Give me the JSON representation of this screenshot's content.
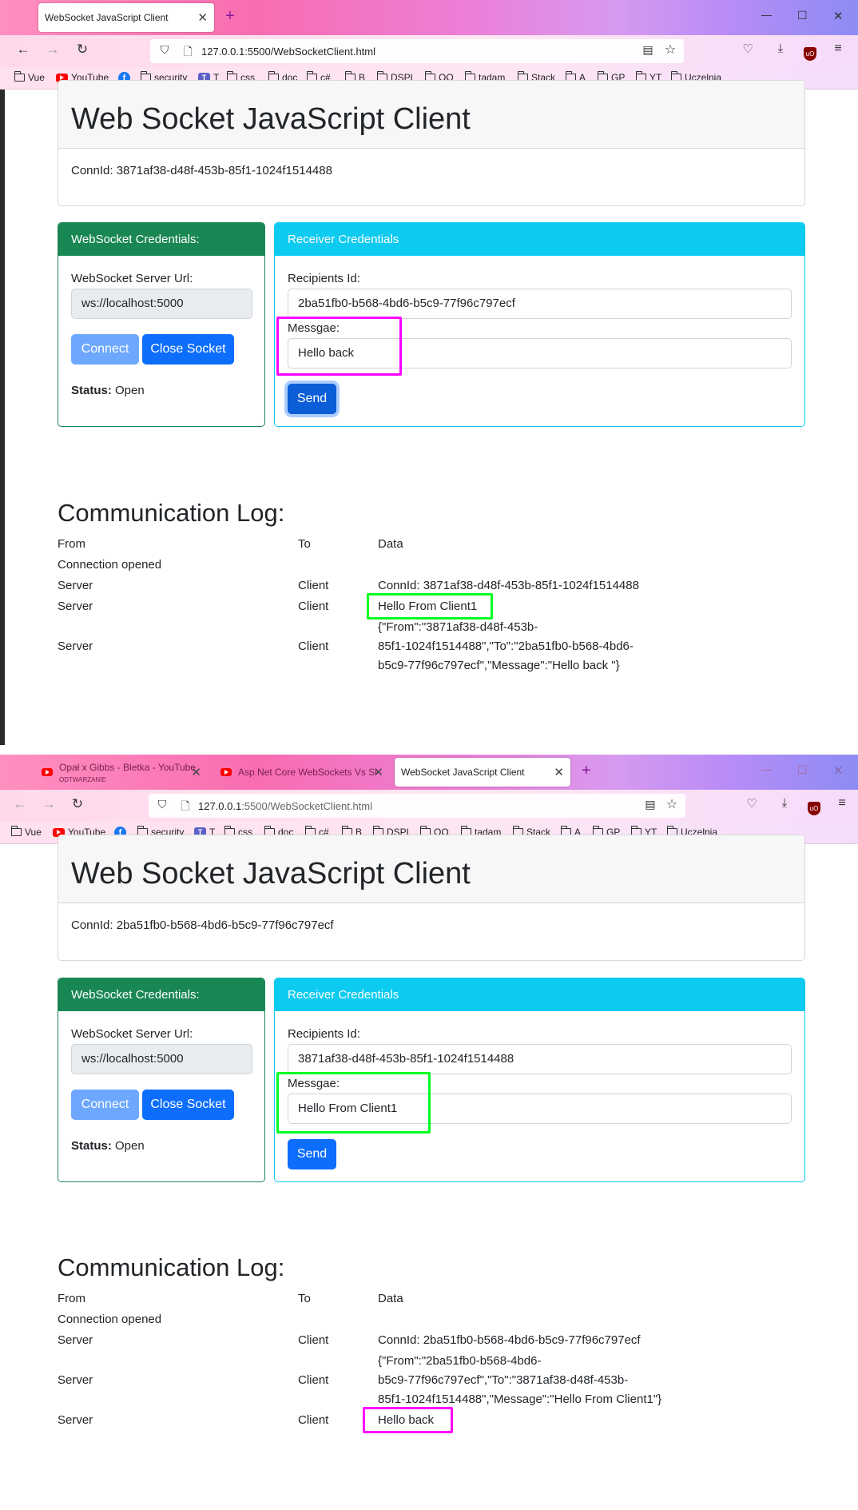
{
  "windows": [
    {
      "tabs": [
        {
          "label": "WebSocket JavaScript Client",
          "active": true
        }
      ],
      "url": {
        "host": "127.0.0.1",
        "rest": ":5500/WebSocketClient.html"
      },
      "page": {
        "title": "Web Socket JavaScript Client",
        "conn_id": "ConnId: 3871af38-d48f-453b-85f1-1024f1514488",
        "ws_panel": {
          "header": "WebSocket Credentials:",
          "url_label": "WebSocket Server Url:",
          "url_value": "ws://localhost:5000",
          "connect_label": "Connect",
          "close_label": "Close Socket",
          "status_label": "Status:",
          "status_value": "Open"
        },
        "receiver_panel": {
          "header": "Receiver Credentials",
          "recipients_label": "Recipients Id:",
          "recipients_value": "2ba51fb0-b568-4bd6-b5c9-77f96c797ecf",
          "message_label": "Messgae:",
          "message_value": "Hello back",
          "send_label": "Send"
        },
        "log": {
          "title": "Communication Log:",
          "headers": {
            "from": "From",
            "to": "To",
            "data": "Data"
          },
          "rows": [
            {
              "from": "Connection opened",
              "to": "",
              "data": ""
            },
            {
              "from": "Server",
              "to": "Client",
              "data": "ConnId: 3871af38-d48f-453b-85f1-1024f1514488"
            },
            {
              "from": "Server",
              "to": "Client",
              "data": "Hello From Client1"
            },
            {
              "from": "Server",
              "to": "Client",
              "data_lines": [
                "{\"From\":\"3871af38-d48f-453b-",
                "85f1-1024f1514488\",\"To\":\"2ba51fb0-b568-4bd6-",
                "b5c9-77f96c797ecf\",\"Message\":\"Hello back \"}"
              ]
            }
          ]
        }
      }
    },
    {
      "tabs": [
        {
          "label": "Opał x Gibbs - Bletka - YouTube",
          "sub": "ODTWARZANIE",
          "active": false
        },
        {
          "label": "Asp.Net Core WebSockets Vs Si",
          "active": false
        },
        {
          "label": "WebSocket JavaScript Client",
          "active": true
        }
      ],
      "url": {
        "host": "127.0.0.1",
        "rest": ":5500/WebSocketClient.html"
      },
      "page": {
        "title": "Web Socket JavaScript Client",
        "conn_id": "ConnId: 2ba51fb0-b568-4bd6-b5c9-77f96c797ecf",
        "ws_panel": {
          "header": "WebSocket Credentials:",
          "url_label": "WebSocket Server Url:",
          "url_value": "ws://localhost:5000",
          "connect_label": "Connect",
          "close_label": "Close Socket",
          "status_label": "Status:",
          "status_value": "Open"
        },
        "receiver_panel": {
          "header": "Receiver Credentials",
          "recipients_label": "Recipients Id:",
          "recipients_value": "3871af38-d48f-453b-85f1-1024f1514488",
          "message_label": "Messgae:",
          "message_value": "Hello From Client1",
          "send_label": "Send"
        },
        "log": {
          "title": "Communication Log:",
          "headers": {
            "from": "From",
            "to": "To",
            "data": "Data"
          },
          "rows": [
            {
              "from": "Connection opened",
              "to": "",
              "data": ""
            },
            {
              "from": "Server",
              "to": "Client",
              "data": "ConnId: 2ba51fb0-b568-4bd6-b5c9-77f96c797ecf"
            },
            {
              "from": "Server",
              "to": "Client",
              "data_lines": [
                "{\"From\":\"2ba51fb0-b568-4bd6-",
                "b5c9-77f96c797ecf\",\"To\":\"3871af38-d48f-453b-",
                "85f1-1024f1514488\",\"Message\":\"Hello From Client1\"}"
              ]
            },
            {
              "from": "Server",
              "to": "Client",
              "data": "Hello back"
            }
          ]
        }
      }
    }
  ],
  "bookmarks": [
    "Vue",
    "YouTube",
    "",
    "security",
    "T",
    "css",
    "doc",
    "c#",
    "B",
    "DSPL",
    "OO",
    "tadam",
    "Stack",
    "A",
    "GP",
    "YT",
    "Uczelnia"
  ],
  "colors": {
    "highlight_magenta": "#ff00ff",
    "highlight_green": "#00ff20",
    "ws_panel": "#198754",
    "receiver_panel": "#0dcaf0",
    "button": "#0d6efd"
  }
}
